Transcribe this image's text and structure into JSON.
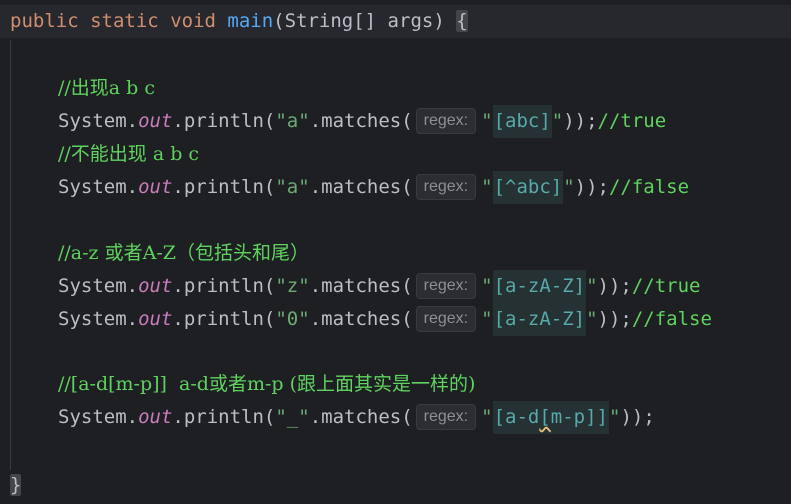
{
  "editor": {
    "signature": {
      "kw_public": "public",
      "kw_static": "static",
      "kw_void": "void",
      "method_name": "main",
      "params": "(String[] args) ",
      "open_brace": "{"
    },
    "closing_brace": "}",
    "inlay_hint_label": "regex:",
    "system_prefix": "System.",
    "out_field": "out",
    "println_call": ".println(",
    "matches_call": ".matches(",
    "lines": [
      {
        "comment": "//出现a b c"
      },
      {
        "subject": "\"a\"",
        "open_quote": "\"",
        "regex": "[abc]",
        "close_quote": "\"",
        "tail": "));",
        "trailing_comment": "//true"
      },
      {
        "comment": "//不能出现 a b c"
      },
      {
        "subject": "\"a\"",
        "open_quote": "\"",
        "regex": "[^abc]",
        "close_quote": "\"",
        "tail": "));",
        "trailing_comment": "//false"
      },
      {
        "comment": "//a-z 或者A-Z（包括头和尾）"
      },
      {
        "subject": "\"z\"",
        "open_quote": "\"",
        "regex": "[a-zA-Z]",
        "close_quote": "\"",
        "tail": "));",
        "trailing_comment": "//true"
      },
      {
        "subject": "\"0\"",
        "open_quote": "\"",
        "regex": "[a-zA-Z]",
        "close_quote": "\"",
        "tail": "));",
        "trailing_comment": "//false"
      },
      {
        "comment": "//[a-d[m-p]]  a-d或者m-p (跟上面其实是一样的)"
      },
      {
        "subject": "\"_\"",
        "open_quote": "\"",
        "regex_part1": "[a-d",
        "regex_squiggle": "[",
        "regex_part2": "m-p]]",
        "close_quote": "\"",
        "tail": "));"
      }
    ]
  },
  "colors": {
    "background": "#1e1f22",
    "keyword": "#cf8e6d",
    "method": "#56a8f5",
    "string": "#6aab73",
    "static_field": "#c77dbb",
    "comment": "#5fd35f",
    "regex_text": "#57aaa9",
    "regex_bg": "#253133",
    "default_text": "#bcbec4"
  }
}
